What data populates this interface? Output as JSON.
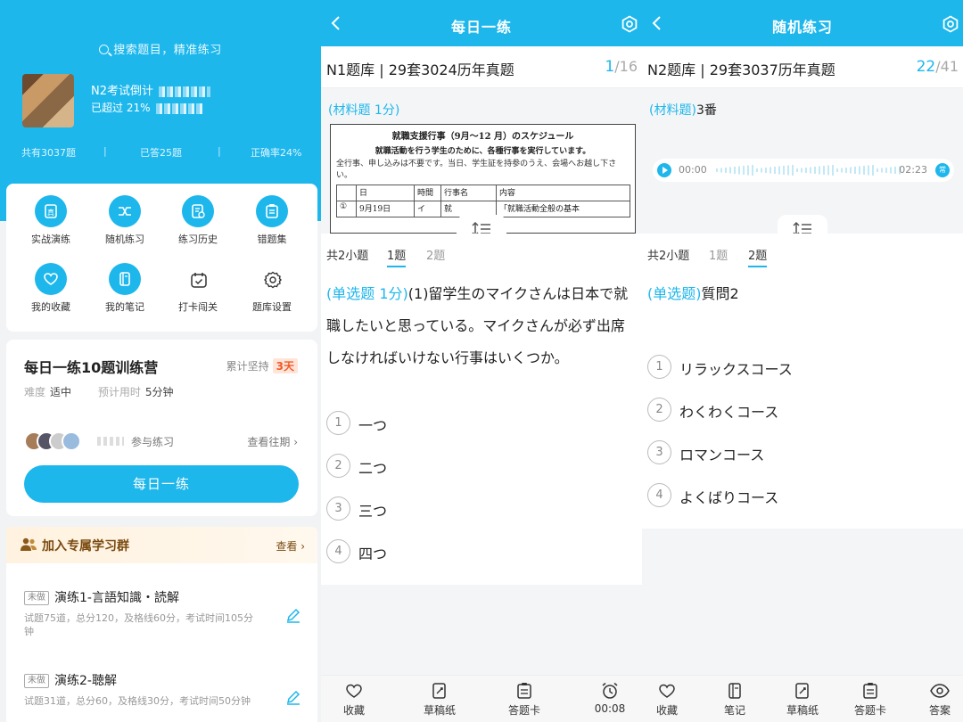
{
  "home": {
    "search_placeholder": "搜索题目，精准练习",
    "user_name": "N2考试倒计",
    "user_percent": "已超过 21%",
    "stats": {
      "total": "共有3037题",
      "answered": "已答25题",
      "accuracy": "正确率24%"
    },
    "grid": [
      {
        "label": "实战演练",
        "icon": "exam-paper-icon"
      },
      {
        "label": "随机练习",
        "icon": "shuffle-icon"
      },
      {
        "label": "练习历史",
        "icon": "history-icon"
      },
      {
        "label": "错题集",
        "icon": "wrong-set-icon"
      },
      {
        "label": "我的收藏",
        "icon": "heart-icon"
      },
      {
        "label": "我的笔记",
        "icon": "notebook-icon"
      },
      {
        "label": "打卡闯关",
        "icon": "calendar-check-icon"
      },
      {
        "label": "题库设置",
        "icon": "gear-icon"
      }
    ],
    "daily": {
      "title": "每日一练10题训练营",
      "streak_label": "累计坚持",
      "streak_value": "3天",
      "difficulty_label": "难度",
      "difficulty_value": "适中",
      "time_label": "预计用时",
      "time_value": "5分钟",
      "join_text": "参与练习",
      "history_link": "查看往期",
      "button": "每日一练"
    },
    "group": {
      "text": "加入专属学习群",
      "link": "查看"
    },
    "exercises": [
      {
        "tag": "未做",
        "title": "演练1-言語知識・読解",
        "desc": "试题75道，总分120，及格线60分，考试时间105分钟"
      },
      {
        "tag": "未做",
        "title": "演练2-聴解",
        "desc": "试题31道，总分60，及格线30分，考试时间50分钟"
      }
    ]
  },
  "daily_practice": {
    "title": "每日一练",
    "bank": "N1题库 | 29套3024历年真题",
    "progress_current": "1",
    "progress_total": "/16",
    "material_label": "(材料题 1分)",
    "material_doc": {
      "heading": "就職支援行事（9月～12 月）のスケジュール",
      "subheading": "就職活動を行う学生のために、各種行事を実行しています。",
      "paragraph": "全行事、申し込みは不要です。当日、学生証を持参のうえ、会場へお越し下さい。",
      "table_header": [
        "",
        "日",
        "時間",
        "行事名",
        "内容"
      ],
      "table_row": [
        "①",
        "9月19日",
        "イ",
        "就",
        "「就職活動全般の基本"
      ]
    },
    "subtabs": {
      "count": "共2小题",
      "tab1": "1题",
      "tab2": "2题"
    },
    "question_type": "(单选题 1分)",
    "question_text": "(1)留学生のマイクさんは日本で就職したいと思っている。マイクさんが必ず出席しなければいけない行事はいくつか。",
    "options": [
      {
        "num": "1",
        "text": "一つ"
      },
      {
        "num": "2",
        "text": "二つ"
      },
      {
        "num": "3",
        "text": "三つ"
      },
      {
        "num": "4",
        "text": "四つ"
      }
    ],
    "footer": [
      {
        "label": "收藏",
        "icon": "heart-outline-icon"
      },
      {
        "label": "草稿纸",
        "icon": "draft-paper-icon"
      },
      {
        "label": "答题卡",
        "icon": "answer-card-icon"
      },
      {
        "label": "00:08",
        "icon": "alarm-clock-icon"
      }
    ]
  },
  "random_practice": {
    "title": "随机练习",
    "bank": "N2题库 | 29套3037历年真题",
    "progress_current": "22",
    "progress_total": "/41",
    "material_label": "(材料题)",
    "material_text": "3番",
    "audio": {
      "current": "00:00",
      "duration": "02:23",
      "speed": "常"
    },
    "subtabs": {
      "count": "共2小题",
      "tab1": "1题",
      "tab2": "2题"
    },
    "question_type": "(单选题)",
    "question_text": "質問2",
    "options": [
      {
        "num": "1",
        "text": "リラックスコース"
      },
      {
        "num": "2",
        "text": "わくわくコース"
      },
      {
        "num": "3",
        "text": "ロマンコース"
      },
      {
        "num": "4",
        "text": "よくばりコース"
      }
    ],
    "footer": [
      {
        "label": "收藏",
        "icon": "heart-outline-icon"
      },
      {
        "label": "笔记",
        "icon": "note-icon"
      },
      {
        "label": "草稿纸",
        "icon": "draft-paper-icon"
      },
      {
        "label": "答题卡",
        "icon": "answer-card-icon"
      },
      {
        "label": "答案",
        "icon": "eye-icon"
      }
    ]
  },
  "colors": {
    "primary": "#1db7ec",
    "streak": "#f05a28",
    "group_text": "#7a4a10"
  }
}
